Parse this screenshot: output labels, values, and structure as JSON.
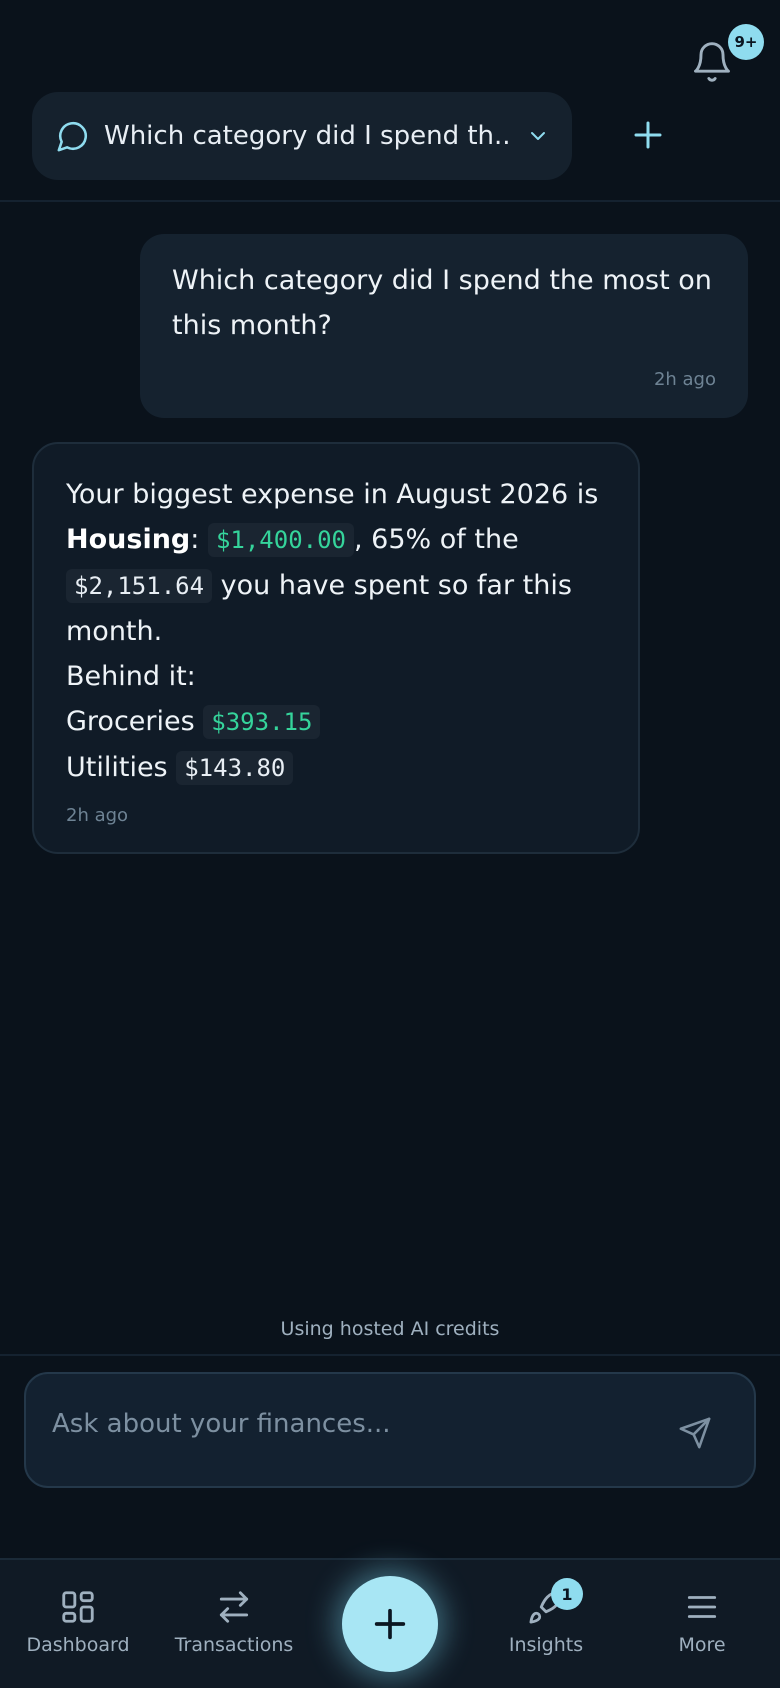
{
  "header": {
    "notification_badge": "9+",
    "conversation_title": "Which category did I spend th..."
  },
  "messages": {
    "user": {
      "text": "Which category did I spend the most on this month?",
      "time": "2h ago"
    },
    "assistant": {
      "line1": "Your biggest expense in August 2026 is",
      "housing_label": "Housing",
      "housing_sep": ":",
      "housing_amount": "$1,400.00",
      "housing_share": ", 65% of the",
      "total_amount": "$2,151.64",
      "total_suffix": "you have spent so far this",
      "line4": "month.",
      "behind_label": "Behind it:",
      "groceries_label": "Groceries",
      "groceries_amount": "$393.15",
      "utilities_label": "Utilities",
      "utilities_amount": "$143.80",
      "time": "2h ago"
    }
  },
  "footer": {
    "credits_text": "Using hosted AI credits",
    "input_placeholder": "Ask about your finances..."
  },
  "nav": {
    "dashboard": "Dashboard",
    "transactions": "Transactions",
    "insights": "Insights",
    "insights_badge": "1",
    "more": "More"
  },
  "colors": {
    "background": "#0a121b",
    "accent": "#8fdcef",
    "money_green": "#35d49b"
  },
  "icons": [
    "bell-icon",
    "chat-bubble-icon",
    "chevron-down-icon",
    "plus-icon",
    "send-icon",
    "dashboard-grid-icon",
    "transfer-arrows-icon",
    "sparkle-rocket-icon",
    "hamburger-menu-icon"
  ]
}
